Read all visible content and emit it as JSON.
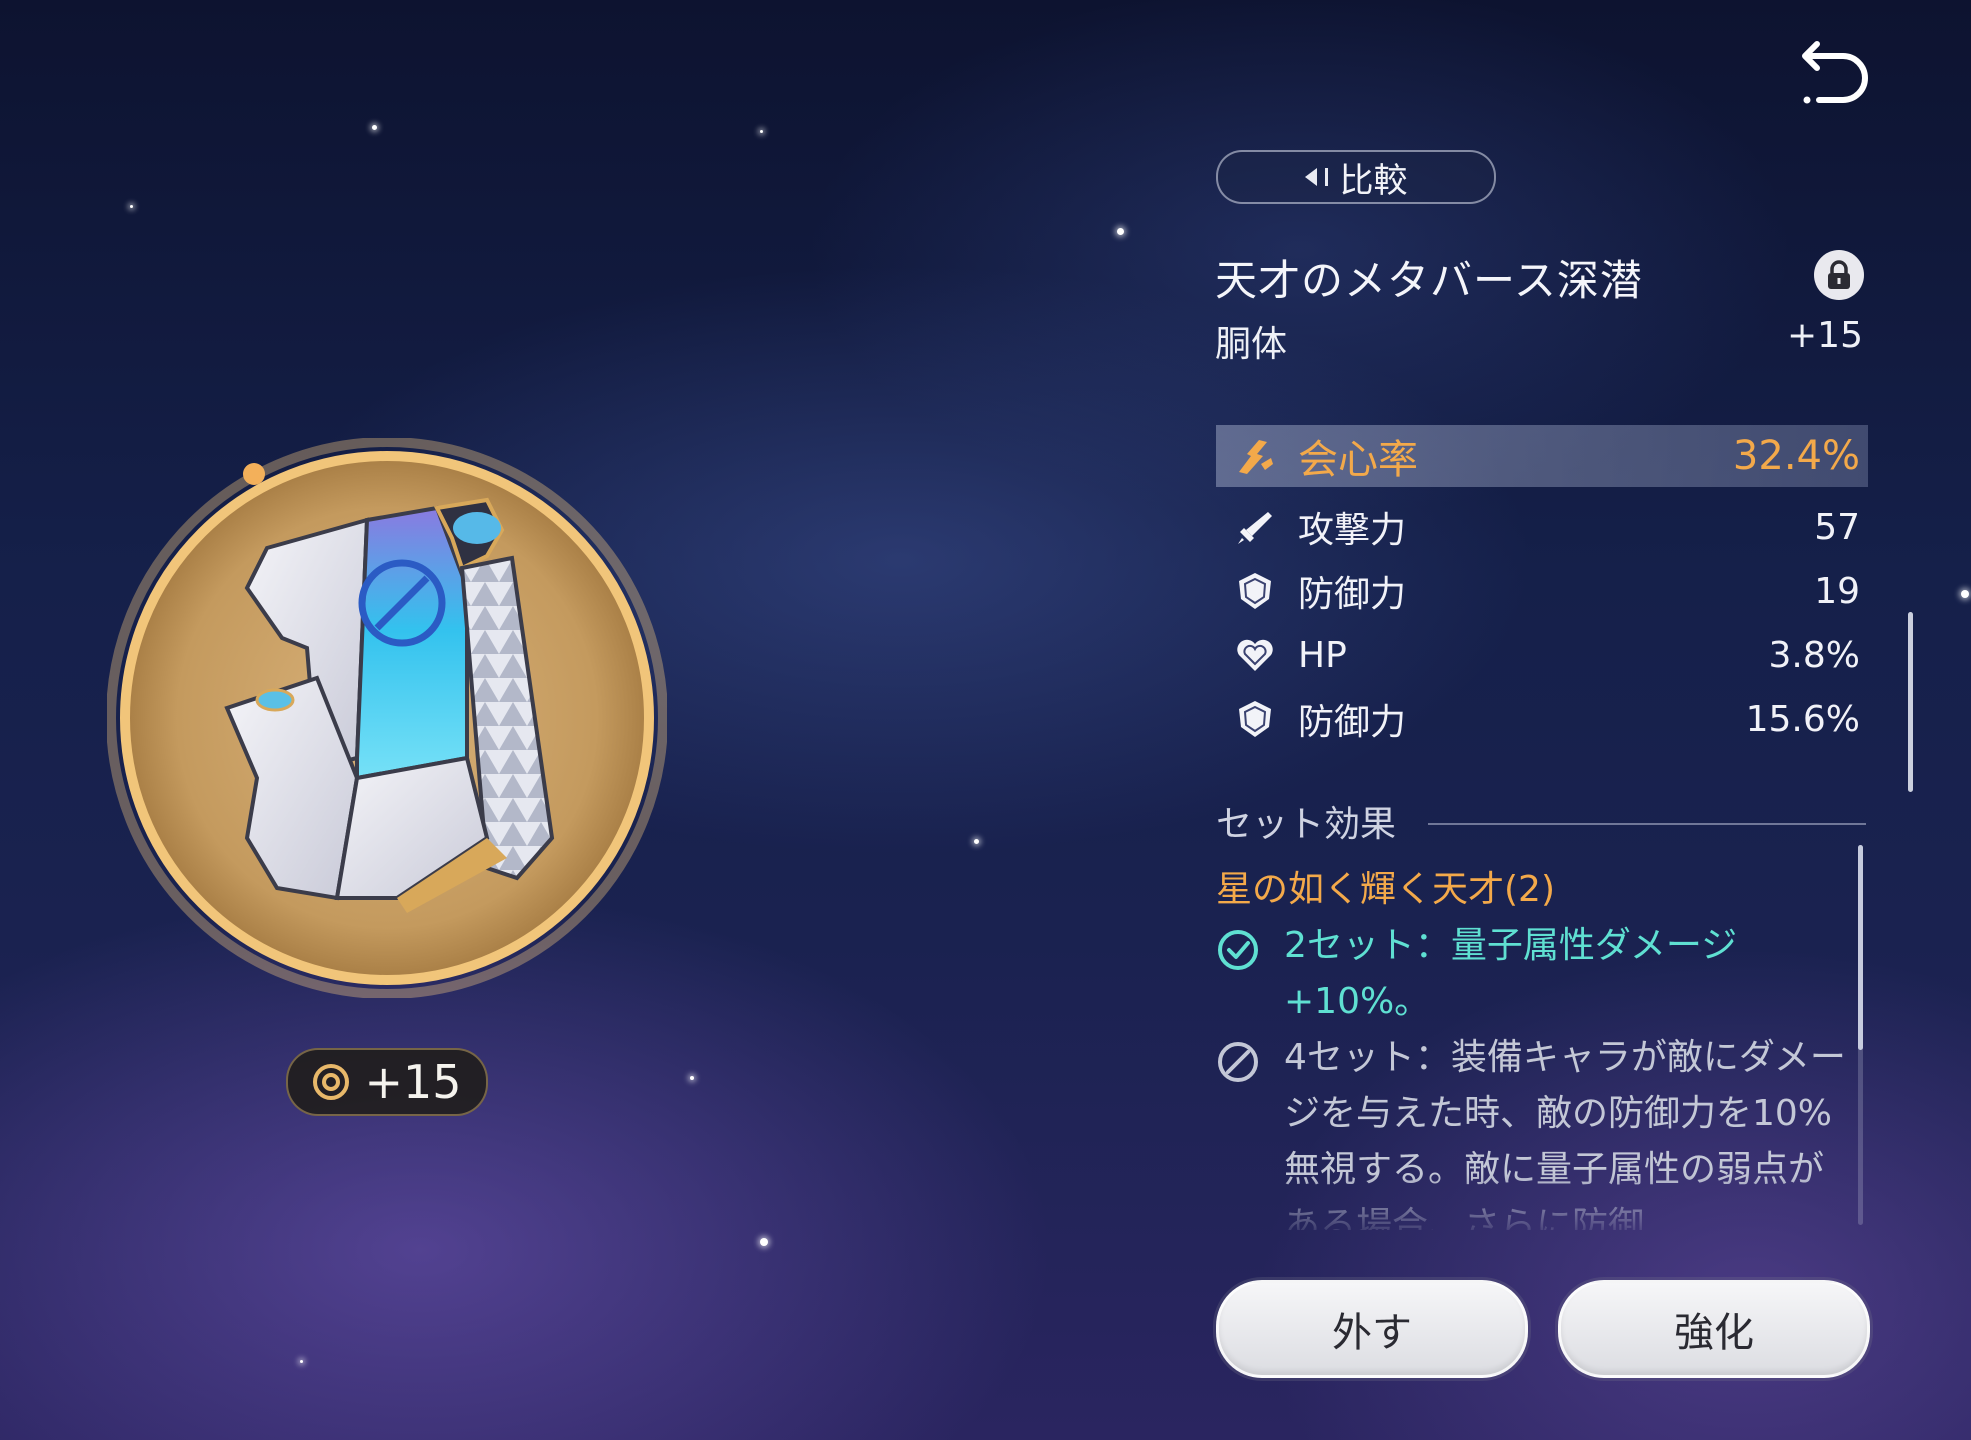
{
  "header": {
    "compare_label": "比較"
  },
  "item": {
    "name": "天才のメタバース深潜",
    "slot": "胴体",
    "level": "+15",
    "badge_level": "+15"
  },
  "stats": {
    "main": {
      "icon": "crit-rate-icon",
      "label": "会心率",
      "value": "32.4%"
    },
    "subs": [
      {
        "icon": "sword-icon",
        "label": "攻撃力",
        "value": "57"
      },
      {
        "icon": "shield-icon",
        "label": "防御力",
        "value": "19"
      },
      {
        "icon": "heart-icon",
        "label": "HP",
        "value": "3.8%"
      },
      {
        "icon": "shield-icon",
        "label": "防御力",
        "value": "15.6%"
      }
    ]
  },
  "set": {
    "heading": "セット効果",
    "name": "星の如く輝く天才(2)",
    "bonus_2": "2セット：量子属性ダメージ+10%。",
    "bonus_4": "4セット：装備キャラが敵にダメージを与えた時、敵の防御力を10%無視する。敵に量子属性の弱点がある場合、さらに防御"
  },
  "actions": {
    "remove": "外す",
    "enhance": "強化"
  },
  "colors": {
    "accent_orange": "#f3a94a",
    "accent_teal": "#5fe0d2",
    "gold": "#e8b86a"
  }
}
